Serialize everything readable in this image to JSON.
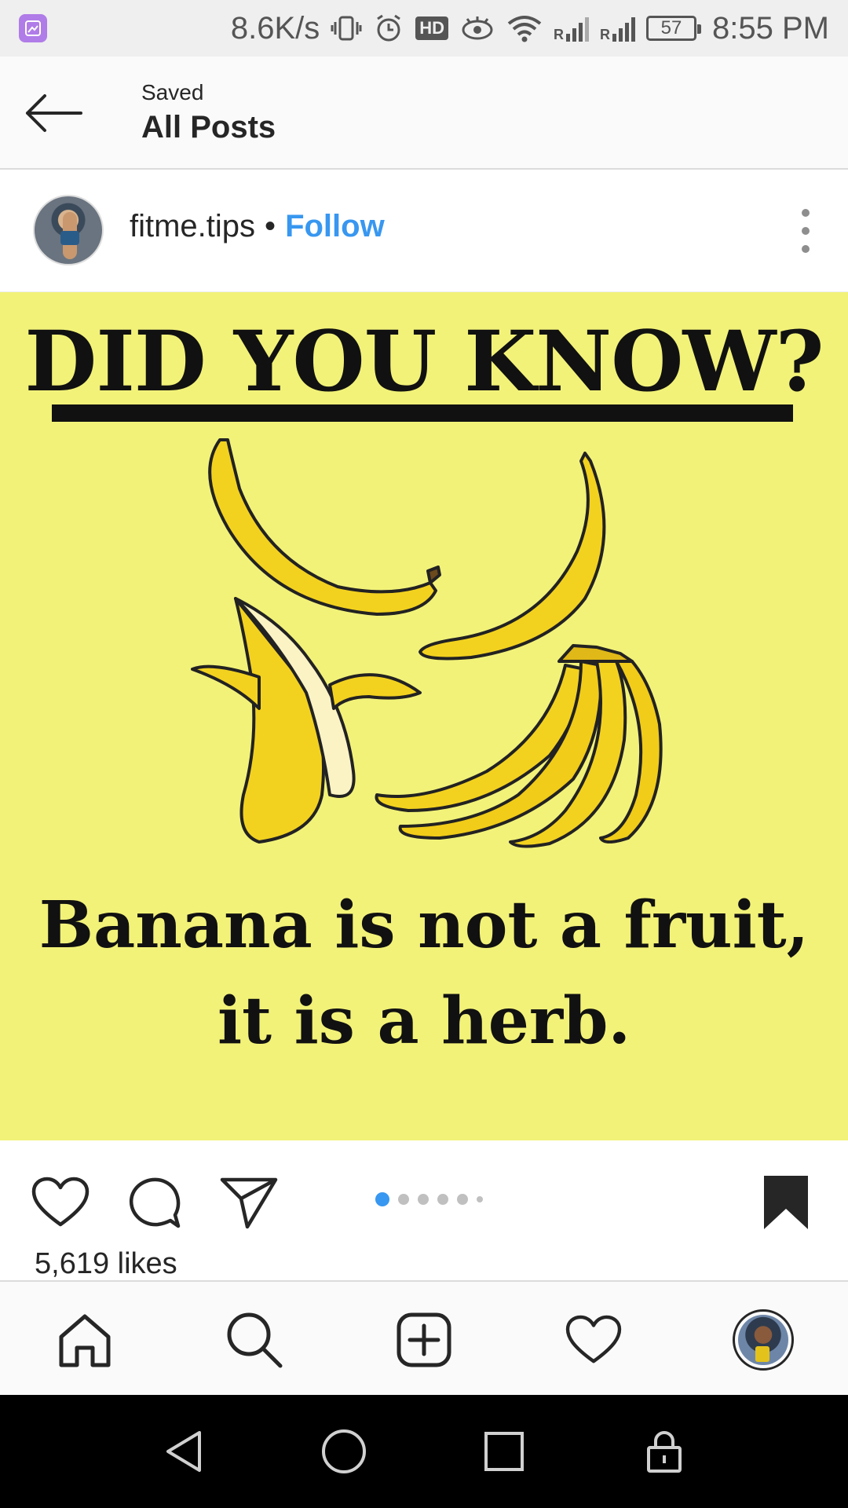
{
  "status_bar": {
    "net_speed": "8.6K/s",
    "hd_badge": "HD",
    "signal_1": "R",
    "signal_2": "R",
    "battery": "57",
    "time": "8:55 PM"
  },
  "header": {
    "subtitle": "Saved",
    "title": "All Posts"
  },
  "post": {
    "username": "fitme.tips",
    "separator": "•",
    "follow_label": "Follow",
    "image": {
      "headline": "DID YOU KNOW?",
      "caption_line1": "Banana is not a fruit,",
      "caption_line2": "it is a herb."
    },
    "carousel": {
      "count": 6,
      "active_index": 0
    },
    "likes": "5,619 likes"
  },
  "colors": {
    "accent": "#3897f0",
    "image_background": "#f2f279",
    "banana": "#f3d21f"
  },
  "icons": {
    "back": "arrow-left-icon",
    "more": "more-vertical-icon",
    "like": "heart-icon",
    "comment": "comment-icon",
    "share": "paper-plane-icon",
    "save": "bookmark-filled-icon",
    "home": "home-icon",
    "search": "search-icon",
    "add": "add-post-icon",
    "activity": "heart-icon",
    "profile": "avatar"
  }
}
